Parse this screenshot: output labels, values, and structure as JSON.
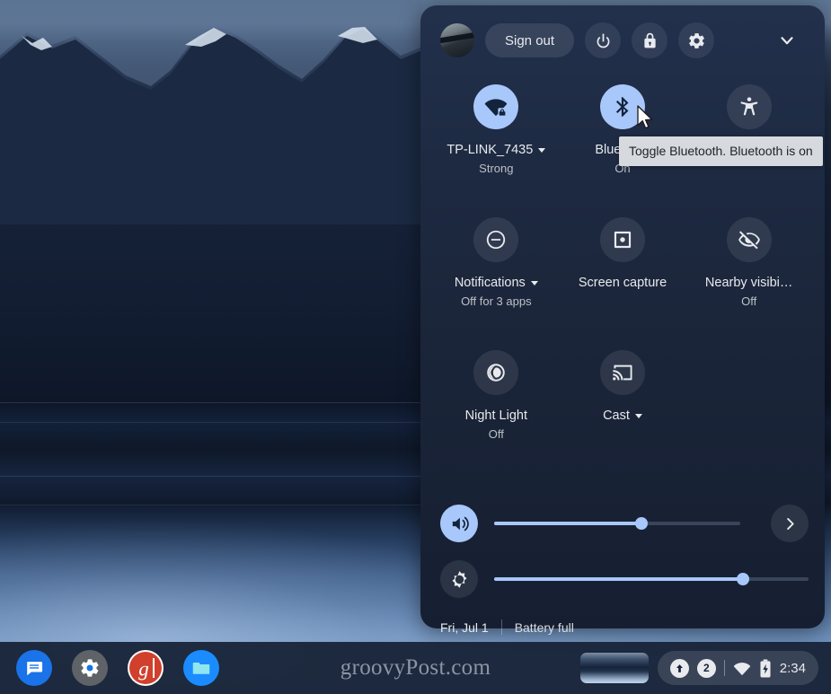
{
  "panel": {
    "header": {
      "avatar_name": "user-avatar",
      "sign_out_label": "Sign out",
      "power_label": "power-icon",
      "lock_label": "lock-icon",
      "settings_label": "settings-gear-icon",
      "collapse_label": "chevron-down-icon"
    },
    "tiles": [
      {
        "icon": "wifi-locked-icon",
        "label": "TP-LINK_7435",
        "sub": "Strong",
        "state": "on",
        "has_caret": true
      },
      {
        "icon": "bluetooth-icon",
        "label": "Bluetooth",
        "sub": "On",
        "state": "on",
        "has_caret": false
      },
      {
        "icon": "accessibility-icon",
        "label": "Accessibility",
        "sub": "",
        "state": "off",
        "has_caret": false
      },
      {
        "icon": "do-not-disturb-icon",
        "label": "Notifications",
        "sub": "Off for 3 apps",
        "state": "off",
        "has_caret": true
      },
      {
        "icon": "screen-capture-icon",
        "label": "Screen capture",
        "sub": "",
        "state": "off",
        "has_caret": false
      },
      {
        "icon": "eye-off-icon",
        "label": "Nearby visibi…",
        "sub": "Off",
        "state": "off",
        "has_caret": false
      },
      {
        "icon": "night-light-icon",
        "label": "Night Light",
        "sub": "Off",
        "state": "off",
        "has_caret": false
      },
      {
        "icon": "cast-icon",
        "label": "Cast",
        "sub": "",
        "state": "off",
        "has_caret": true
      }
    ],
    "sliders": {
      "volume": {
        "icon": "volume-up-icon",
        "value": 60,
        "state": "on"
      },
      "brightness": {
        "icon": "brightness-icon",
        "value": 79,
        "state": "off"
      },
      "audio_settings_icon": "chevron-right-icon"
    },
    "footer": {
      "date": "Fri, Jul 1",
      "battery": "Battery full"
    },
    "tooltip": "Toggle Bluetooth. Bluetooth is on",
    "accent_on": "#a8c7fa",
    "background": "#1d2940"
  },
  "shelf": {
    "apps": [
      {
        "name": "messages",
        "glyph": "messages-icon",
        "color": "#1a73e8"
      },
      {
        "name": "settings",
        "glyph": "settings-gear-icon",
        "color": "#5f6368"
      },
      {
        "name": "groovypost",
        "glyph": "g",
        "color": "#ffffff"
      },
      {
        "name": "files",
        "glyph": "folder-icon",
        "color": "#1a8cff"
      }
    ],
    "watermark": "groovyPost.com",
    "window_preview": "window-preview-thumbnail",
    "status": {
      "upload_icon": "arrow-up-circle-icon",
      "badge_count": "2",
      "wifi_icon": "wifi-icon",
      "battery_icon": "battery-charging-icon",
      "clock": "2:34"
    }
  }
}
